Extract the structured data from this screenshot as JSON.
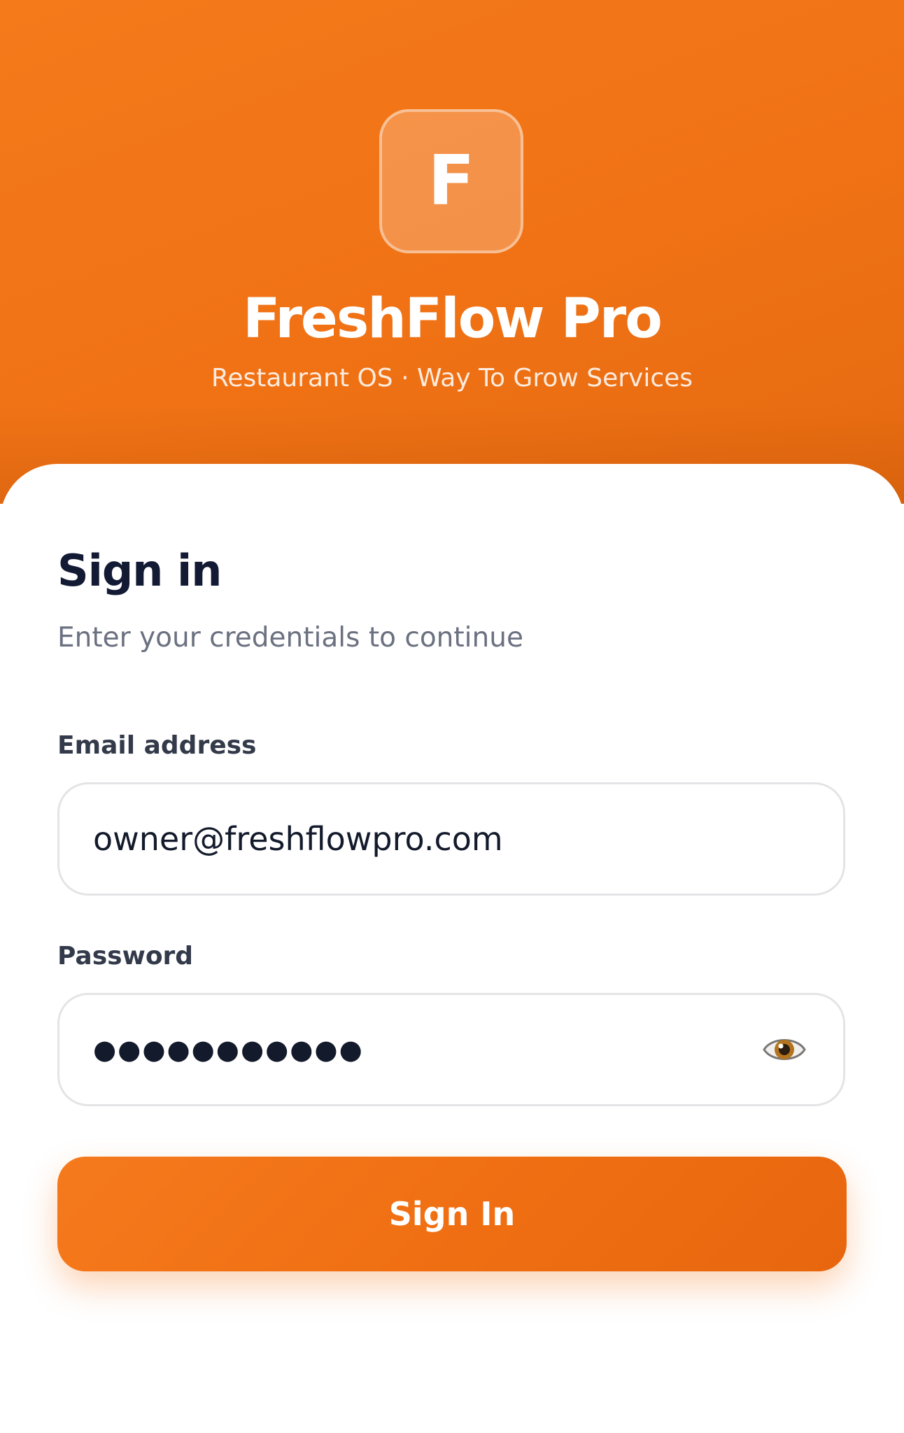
{
  "brand": {
    "logo_letter": "F",
    "name": "FreshFlow Pro",
    "tagline": "Restaurant OS · Way To Grow Services"
  },
  "sign_in": {
    "title": "Sign in",
    "subtitle": "Enter your credentials to continue",
    "email": {
      "label": "Email address",
      "value": "owner@freshflowpro.com"
    },
    "password": {
      "label": "Password",
      "masked_value": "●●●●●●●●●●●",
      "toggle_icon": "eye-icon"
    },
    "submit_label": "Sign In"
  },
  "colors": {
    "brand_orange": "#f47a1a",
    "title_text": "#131a33",
    "subtitle_text": "#6b7180",
    "input_border": "#e4e4e7"
  }
}
